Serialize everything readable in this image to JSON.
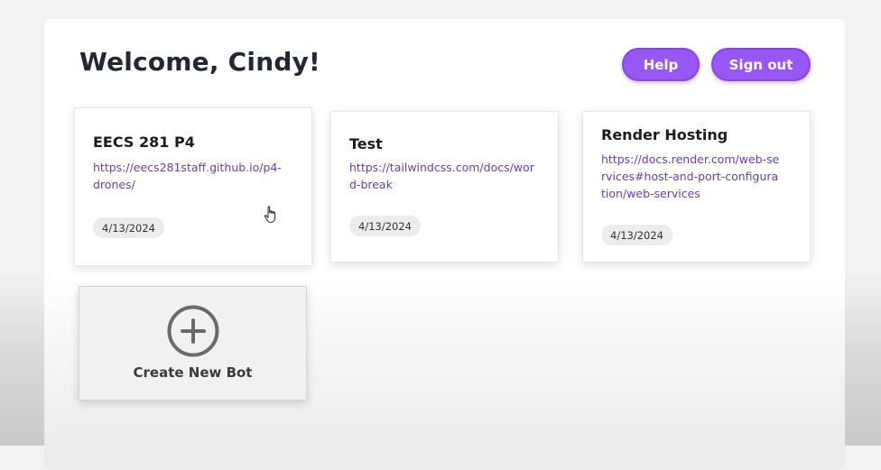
{
  "header": {
    "title": "Welcome, Cindy!",
    "help_label": "Help",
    "signout_label": "Sign out"
  },
  "cards": [
    {
      "title": "EECS 281 P4",
      "url": "https://eecs281staff.github.io/p4-drones/",
      "date": "4/13/2024"
    },
    {
      "title": "Test",
      "url": "https://tailwindcss.com/docs/word-break",
      "date": "4/13/2024"
    },
    {
      "title": "Render Hosting",
      "url": "https://docs.render.com/web-services#host-and-port-configuration/web-services",
      "date": "4/13/2024"
    }
  ],
  "create": {
    "label": "Create New Bot",
    "icon": "plus-circle-icon"
  },
  "colors": {
    "accent": "#9757f2",
    "link": "#6b3fa6",
    "title": "#222831",
    "badge_bg": "#ececec"
  }
}
